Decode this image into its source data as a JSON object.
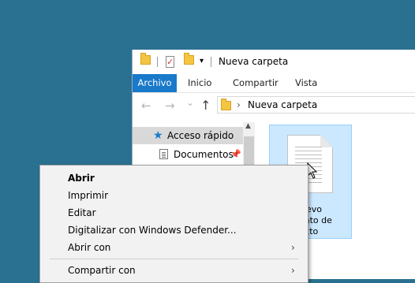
{
  "window": {
    "title": "Nueva carpeta",
    "qa_dropdown_glyph": "▾",
    "check_glyph": "✓"
  },
  "ribbon": {
    "tabs": [
      {
        "label": "Archivo"
      },
      {
        "label": "Inicio"
      },
      {
        "label": "Compartir"
      },
      {
        "label": "Vista"
      }
    ]
  },
  "address": {
    "back_glyph": "←",
    "forward_glyph": "→",
    "recent_glyph": "⌄",
    "up_glyph": "↑",
    "chevron_glyph": "›",
    "path": "Nueva carpeta"
  },
  "navpane": {
    "items": [
      {
        "label": "Acceso rápido",
        "icon": "star-icon",
        "selected": true
      },
      {
        "label": "Documentos",
        "icon": "documents-icon",
        "pinned": true
      }
    ],
    "star_glyph": "★",
    "pin_glyph": "📌",
    "scroll_up_glyph": "▲"
  },
  "file": {
    "label_lines": [
      "uevo",
      "mento de",
      "xto"
    ],
    "icon": "text-document-icon"
  },
  "context_menu": {
    "items": [
      {
        "label": "Abrir",
        "bold": true
      },
      {
        "label": "Imprimir"
      },
      {
        "label": "Editar"
      },
      {
        "label": "Digitalizar con Windows Defender..."
      },
      {
        "label": "Abrir con",
        "submenu": true
      },
      {
        "label": "Compartir con",
        "submenu": true
      }
    ],
    "submenu_glyph": "›"
  },
  "colors": {
    "desktop": "#2a7091",
    "accent": "#1979ca",
    "selection": "#cce8ff"
  }
}
